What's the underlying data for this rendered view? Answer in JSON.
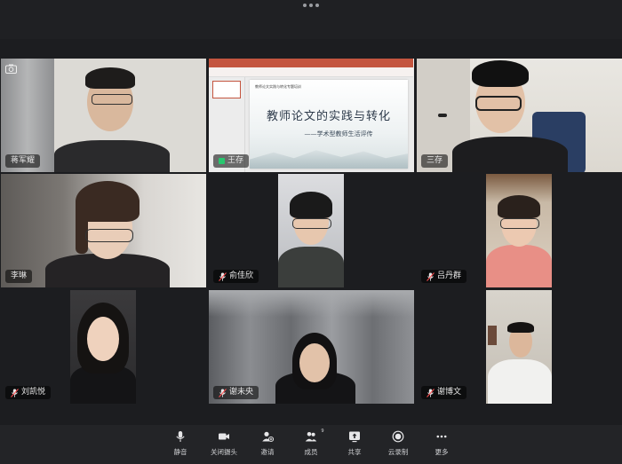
{
  "app": {
    "title_dots_icon": "more-dots-icon"
  },
  "participants": [
    {
      "name": "蒋军耀",
      "muted": false,
      "icon": "camera-icon"
    },
    {
      "name": "王存",
      "muted": false,
      "sharing": true
    },
    {
      "name": "三存",
      "muted": false
    },
    {
      "name": "李琳",
      "muted": false
    },
    {
      "name": "俞佳欣",
      "muted": true
    },
    {
      "name": "吕丹群",
      "muted": true
    },
    {
      "name": "刘凯悦",
      "muted": true
    },
    {
      "name": "谢未央",
      "muted": true
    },
    {
      "name": "谢博文",
      "muted": true
    }
  ],
  "shared_slide": {
    "header_small": "教师论文实践与转化专题培训",
    "title": "教师论文的实践与转化",
    "subtitle": "——学术型教师生活评传"
  },
  "toolbar": {
    "items": [
      {
        "label": "静音",
        "icon": "microphone-icon"
      },
      {
        "label": "关闭摄头",
        "icon": "video-camera-icon"
      },
      {
        "label": "邀请",
        "icon": "invite-user-icon"
      },
      {
        "label": "成员",
        "icon": "members-icon",
        "badge": "9"
      },
      {
        "label": "共享",
        "icon": "share-screen-icon"
      },
      {
        "label": "云录制",
        "icon": "record-icon"
      },
      {
        "label": "更多",
        "icon": "more-icon"
      }
    ]
  },
  "colors": {
    "background": "#1f2023",
    "share_indicator": "#28c76f",
    "slide_ribbon": "#c4553f"
  }
}
